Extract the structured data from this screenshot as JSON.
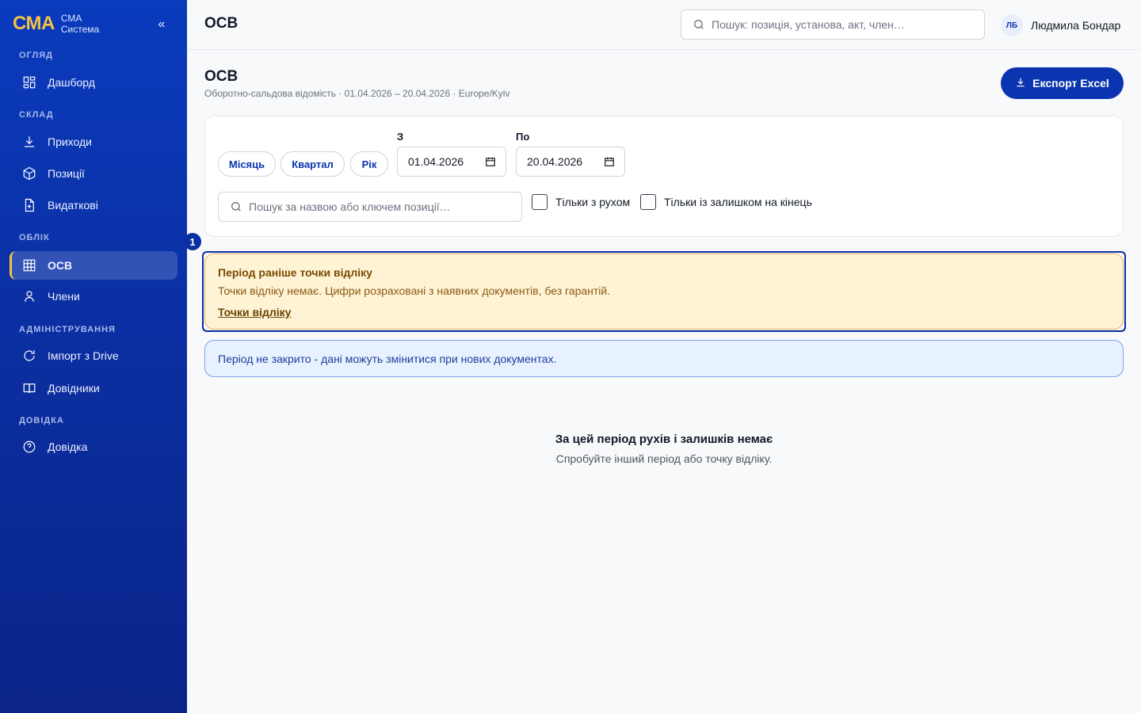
{
  "brand": {
    "logo": "СМА",
    "line1": "СМА",
    "line2": "Система",
    "collapse": "«"
  },
  "sidebar": {
    "sections": [
      {
        "title": "ОГЛЯД"
      },
      {
        "title": "СКЛАД"
      },
      {
        "title": "ОБЛІК"
      },
      {
        "title": "АДМІНІСТРУВАННЯ"
      },
      {
        "title": "ДОВІДКА"
      }
    ],
    "items": [
      {
        "label": "Дашборд",
        "icon": "dashboard-icon"
      },
      {
        "label": "Приходи",
        "icon": "download-icon"
      },
      {
        "label": "Позиції",
        "icon": "box-icon"
      },
      {
        "label": "Видаткові",
        "icon": "document-icon"
      },
      {
        "label": "ОСВ",
        "icon": "table-icon",
        "active": true
      },
      {
        "label": "Члени",
        "icon": "user-icon"
      },
      {
        "label": "Імпорт з Drive",
        "icon": "refresh-icon"
      },
      {
        "label": "Довідники",
        "icon": "book-icon"
      },
      {
        "label": "Довідка",
        "icon": "help-icon"
      }
    ]
  },
  "header": {
    "title": "ОСВ",
    "search_placeholder": "Пошук: позиція, установа, акт, член…",
    "user_initials": "ЛБ",
    "user_name": "Людмила Бондар"
  },
  "page": {
    "title": "ОСВ",
    "subtitle": "Оборотно-сальдова відомість · 01.04.2026 – 20.04.2026 · Europe/Kyiv",
    "export_label": "Експорт Excel"
  },
  "filters": {
    "presets": [
      "Місяць",
      "Квартал",
      "Рік"
    ],
    "from_label": "З",
    "from_value": "01.04.2026",
    "to_label": "По",
    "to_value": "20.04.2026",
    "search_placeholder": "Пошук за назвою або ключем позиції…",
    "only_movement": "Тільки з рухом",
    "only_balance": "Тільки із залишком на кінець"
  },
  "alerts": {
    "step": "1",
    "warning_title": "Період раніше точки відліку",
    "warning_text": "Точки відліку немає. Цифри розраховані з наявних документів, без гарантій.",
    "warning_link": "Точки відліку",
    "info_text": "Період не закрито - дані можуть змінитися при нових документах."
  },
  "empty": {
    "title": "За цей період рухів і залишків немає",
    "text": "Спробуйте інший період або точку відліку."
  },
  "colors": {
    "primary": "#0b35b0",
    "accent": "#f5c342",
    "warning_bg": "#fff3d6",
    "info_bg": "#e8f1ff"
  }
}
